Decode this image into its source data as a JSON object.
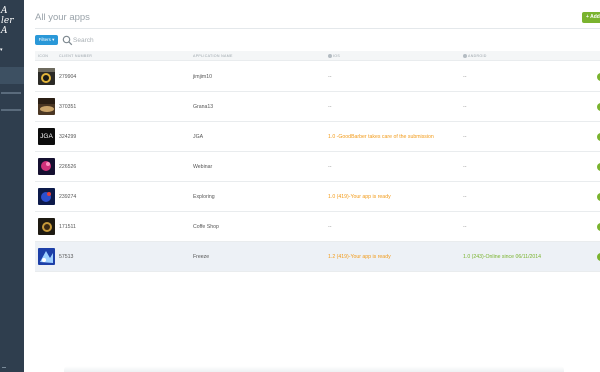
{
  "sidebar": {
    "logo_text": [
      "A",
      "ler",
      "A"
    ],
    "menu_caret": "▾"
  },
  "header": {
    "title": "All your apps",
    "add_button_label": "+ Add"
  },
  "toolbar": {
    "filters_label": "Filters ▾",
    "search_placeholder": "Search"
  },
  "table": {
    "columns": [
      "Icon",
      "Client number",
      "Application name",
      "iOS",
      "Android"
    ],
    "rows": [
      {
        "client_number": "279904",
        "app_name": "jimjim10",
        "ios": "--",
        "ios_color": "#888888",
        "android": "--",
        "android_color": "#888888",
        "icon": "app-thumbnail-dark-circle",
        "highlight": false
      },
      {
        "client_number": "370351",
        "app_name": "Grana13",
        "ios": "--",
        "ios_color": "#888888",
        "android": "--",
        "android_color": "#888888",
        "icon": "app-thumbnail-food",
        "highlight": false
      },
      {
        "client_number": "324299",
        "app_name": "JGA",
        "ios": "1.0 -GoodBarber takes care of the submission",
        "ios_color": "#f29a18",
        "android": "--",
        "android_color": "#888888",
        "icon": "app-thumbnail-jga",
        "icon_text": "JGA",
        "highlight": false
      },
      {
        "client_number": "226526",
        "app_name": "Webinar",
        "ios": "--",
        "ios_color": "#888888",
        "android": "--",
        "android_color": "#888888",
        "icon": "app-thumbnail-pink-bird",
        "highlight": false
      },
      {
        "client_number": "239274",
        "app_name": "Exploring",
        "ios": "1.0 (419)-Your app is ready",
        "ios_color": "#f29a18",
        "android": "--",
        "android_color": "#888888",
        "icon": "app-thumbnail-blue-creature",
        "highlight": false
      },
      {
        "client_number": "171511",
        "app_name": "Coffe Shop",
        "ios": "--",
        "ios_color": "#888888",
        "android": "--",
        "android_color": "#888888",
        "icon": "app-thumbnail-coffee",
        "highlight": false
      },
      {
        "client_number": "57513",
        "app_name": "Freeze",
        "ios": "1.2 (419)-Your app is ready",
        "ios_color": "#f29a18",
        "android": "1.0 (243)-Online since 06/11/2014",
        "android_color": "#79b32e",
        "icon": "app-thumbnail-blue-splash",
        "highlight": true
      }
    ]
  },
  "colors": {
    "sidebar_bg": "#2f3e4e",
    "accent_blue": "#2a98d8",
    "accent_green": "#7ab32e",
    "pending_orange": "#f29a18",
    "row_highlight": "#edf1f6"
  }
}
